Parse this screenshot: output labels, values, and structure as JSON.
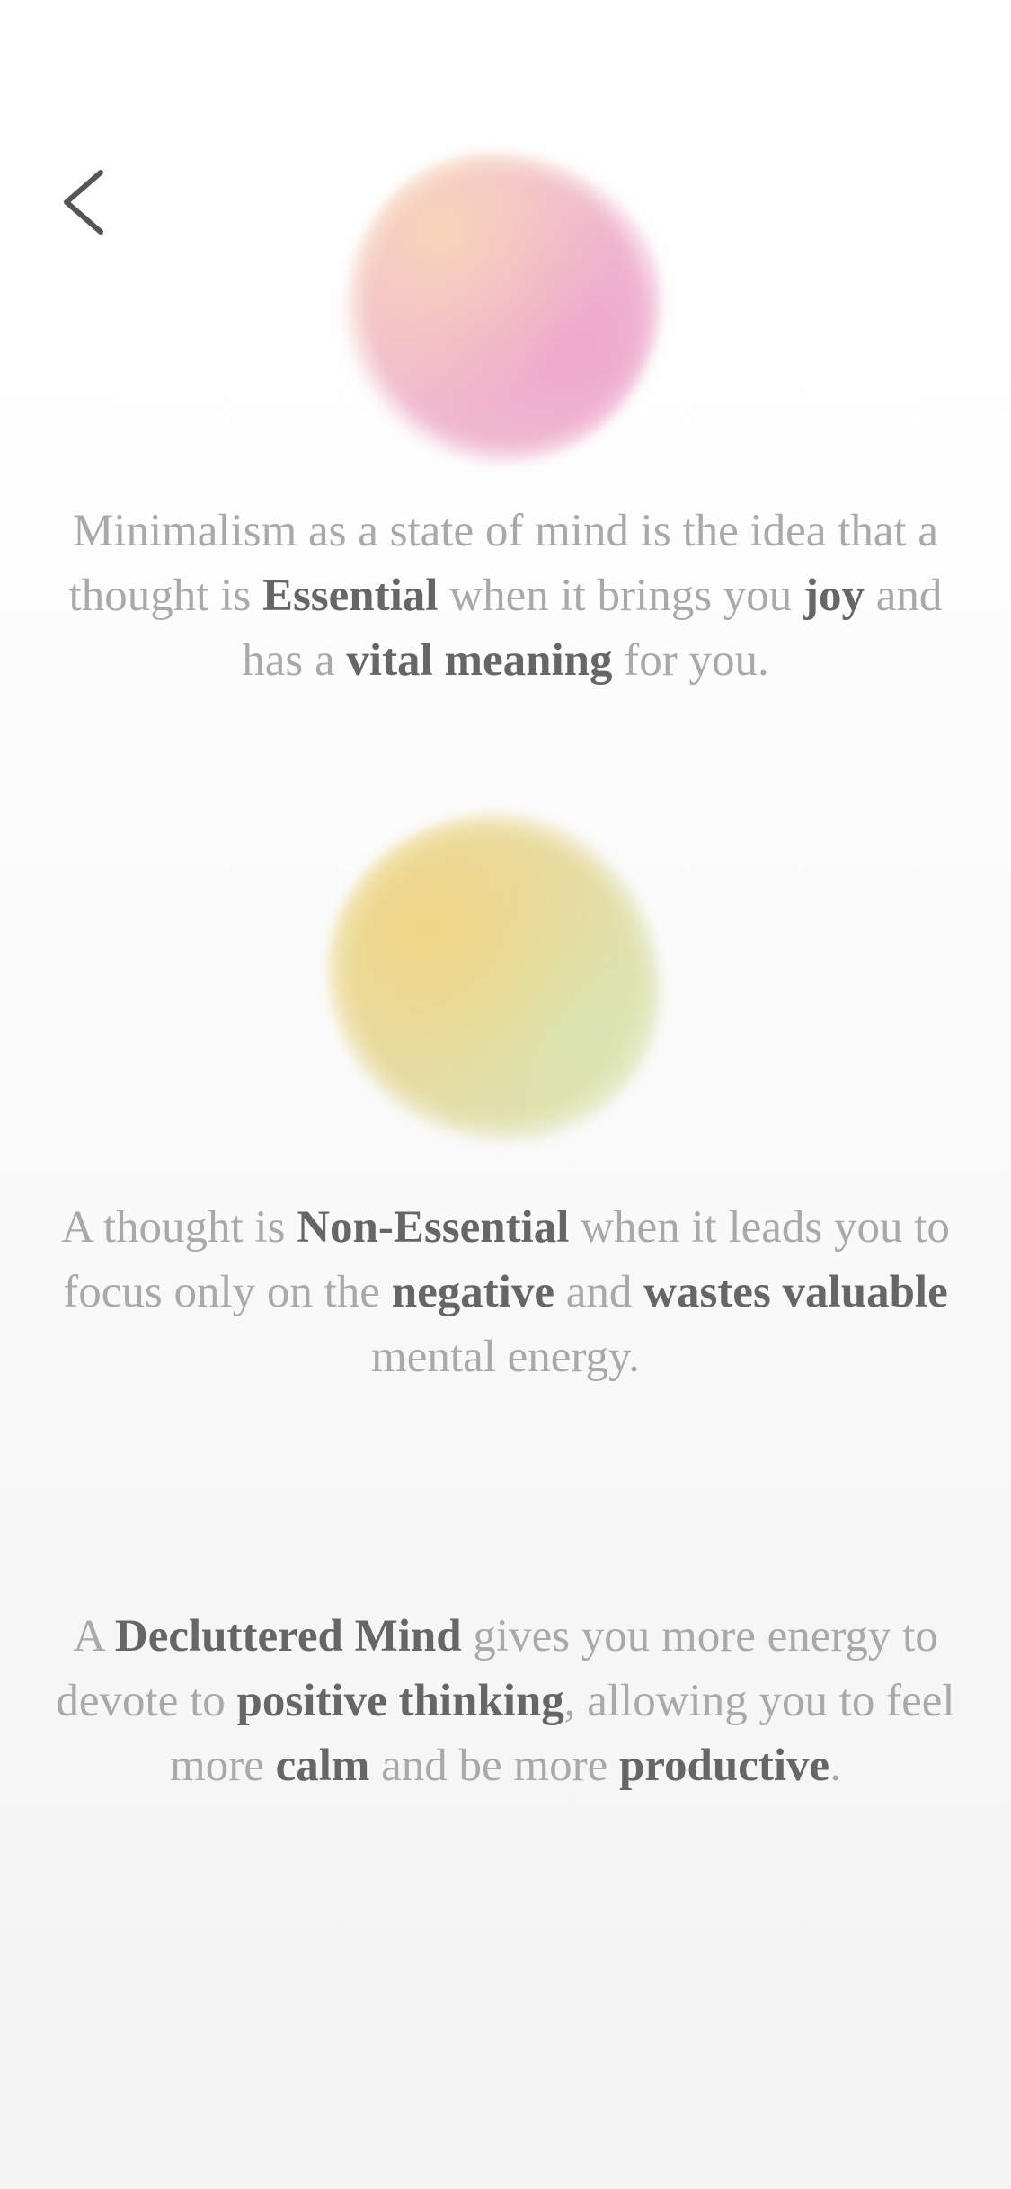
{
  "back_button": {
    "icon": "chevron-left-icon"
  },
  "blobs": [
    {
      "name": "pink",
      "colors": [
        "#f8d6ba",
        "#eea6cd"
      ]
    },
    {
      "name": "yellow",
      "colors": [
        "#f0d684",
        "#d8e6b4"
      ]
    }
  ],
  "sections": {
    "essential": {
      "p1": "Minimalism as a state of mind is the idea that a thought is ",
      "b1": "Essential",
      "p2": " when it brings you ",
      "b2": "joy",
      "p3": " and has a ",
      "b3": "vital meaning",
      "p4": " for you."
    },
    "non_essential": {
      "p1": "A thought is ",
      "b1": "Non-Essential",
      "p2": " when it leads you to focus only on the ",
      "b2": "negative",
      "p3": " and ",
      "b3": "wastes valuable",
      "p4": " mental energy."
    },
    "decluttered": {
      "p1": "A ",
      "b1": "Decluttered Mind",
      "p2": " gives you more energy to devote to ",
      "b2": "positive thinking",
      "p3": ", allowing you to feel more ",
      "b3": "calm",
      "p4": " and be more ",
      "b4": "productive",
      "p5": "."
    }
  }
}
